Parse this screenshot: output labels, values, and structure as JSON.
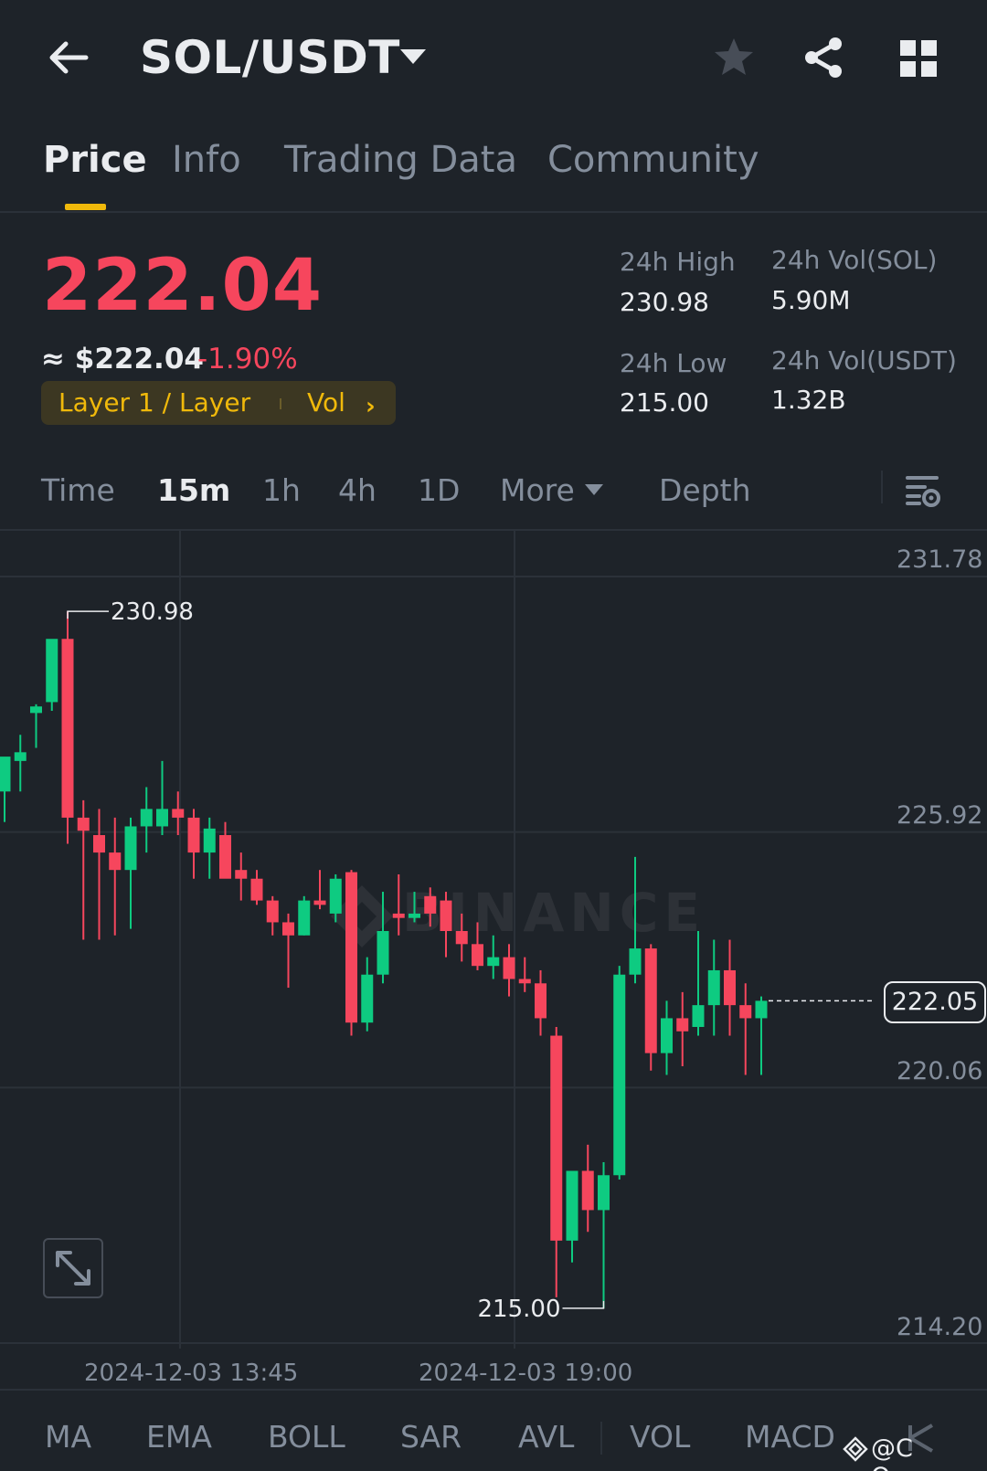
{
  "header": {
    "pair": "SOL/USDT",
    "icons": [
      "arrow-left-icon",
      "caret-down-icon",
      "star-icon",
      "share-icon",
      "grid-icon"
    ]
  },
  "tabs": [
    {
      "label": "Price",
      "active": true
    },
    {
      "label": "Info",
      "active": false
    },
    {
      "label": "Trading Data",
      "active": false
    },
    {
      "label": "Community",
      "active": false
    }
  ],
  "price": {
    "last": "222.04",
    "approx_usd": "≈ $222.04",
    "change": "-1.90%",
    "tag": "Layer 1 / Layer",
    "tag_vol": "Vol"
  },
  "stats": {
    "high_label": "24h High",
    "high_value": "230.98",
    "low_label": "24h Low",
    "low_value": "215.00",
    "vol_sol_label": "24h Vol(SOL)",
    "vol_sol_value": "5.90M",
    "vol_usdt_label": "24h Vol(USDT)",
    "vol_usdt_value": "1.32B"
  },
  "intervals": {
    "items": [
      "Time",
      "15m",
      "1h",
      "4h",
      "1D"
    ],
    "selected": "15m",
    "more": "More",
    "depth": "Depth"
  },
  "chart": {
    "y_ticks": [
      "231.78",
      "225.92",
      "220.06",
      "214.20"
    ],
    "x_ticks": [
      "2024-12-03 13:45",
      "2024-12-03 19:00"
    ],
    "high_marker": "230.98",
    "low_marker": "215.00",
    "last_price": "222.05",
    "watermark": "BINANCE",
    "colors": {
      "up": "#0ecb81",
      "down": "#f6465d",
      "accent": "#f0b90b",
      "bg": "#1e2329"
    }
  },
  "chart_data": {
    "type": "candlestick",
    "ylim": [
      214.2,
      231.78
    ],
    "y_ticks": [
      231.78,
      225.92,
      220.06,
      214.2
    ],
    "x_ticks": [
      "2024-12-03 13:45",
      "2024-12-03 19:00"
    ],
    "interval": "15m",
    "candles": [
      {
        "o": 226.85,
        "h": 227.05,
        "l": 226.15,
        "c": 227.65
      },
      {
        "o": 227.55,
        "h": 228.15,
        "l": 226.85,
        "c": 227.75
      },
      {
        "o": 228.65,
        "h": 228.85,
        "l": 227.85,
        "c": 228.8
      },
      {
        "o": 228.9,
        "h": 230.25,
        "l": 228.7,
        "c": 230.35
      },
      {
        "o": 230.35,
        "h": 230.98,
        "l": 225.65,
        "c": 226.25
      },
      {
        "o": 226.25,
        "h": 226.65,
        "l": 223.45,
        "c": 225.95
      },
      {
        "o": 225.85,
        "h": 226.45,
        "l": 223.45,
        "c": 225.45
      },
      {
        "o": 225.45,
        "h": 226.25,
        "l": 223.55,
        "c": 225.05
      },
      {
        "o": 225.05,
        "h": 226.25,
        "l": 223.7,
        "c": 226.05
      },
      {
        "o": 226.05,
        "h": 226.95,
        "l": 225.45,
        "c": 226.45
      },
      {
        "o": 226.05,
        "h": 227.55,
        "l": 225.85,
        "c": 226.45
      },
      {
        "o": 226.45,
        "h": 226.85,
        "l": 225.85,
        "c": 226.25
      },
      {
        "o": 226.25,
        "h": 226.45,
        "l": 224.85,
        "c": 225.45
      },
      {
        "o": 225.45,
        "h": 226.25,
        "l": 224.85,
        "c": 226.0
      },
      {
        "o": 225.85,
        "h": 226.15,
        "l": 225.05,
        "c": 224.85
      },
      {
        "o": 225.05,
        "h": 225.45,
        "l": 224.35,
        "c": 224.85
      },
      {
        "o": 224.85,
        "h": 225.05,
        "l": 224.25,
        "c": 224.35
      },
      {
        "o": 224.35,
        "h": 224.45,
        "l": 223.55,
        "c": 223.85
      },
      {
        "o": 223.85,
        "h": 224.05,
        "l": 222.35,
        "c": 223.55
      },
      {
        "o": 223.55,
        "h": 224.45,
        "l": 223.55,
        "c": 224.35
      },
      {
        "o": 224.35,
        "h": 225.05,
        "l": 224.15,
        "c": 224.25
      },
      {
        "o": 224.05,
        "h": 224.95,
        "l": 223.85,
        "c": 224.85
      },
      {
        "o": 225.0,
        "h": 225.05,
        "l": 221.25,
        "c": 221.55
      },
      {
        "o": 221.55,
        "h": 223.05,
        "l": 221.35,
        "c": 222.65
      },
      {
        "o": 222.65,
        "h": 224.55,
        "l": 222.45,
        "c": 223.65
      },
      {
        "o": 224.05,
        "h": 224.95,
        "l": 223.55,
        "c": 223.95
      },
      {
        "o": 223.95,
        "h": 224.55,
        "l": 223.85,
        "c": 224.05
      },
      {
        "o": 224.45,
        "h": 224.65,
        "l": 223.75,
        "c": 224.05
      },
      {
        "o": 224.35,
        "h": 224.55,
        "l": 223.05,
        "c": 223.65
      },
      {
        "o": 223.65,
        "h": 224.05,
        "l": 222.95,
        "c": 223.35
      },
      {
        "o": 223.35,
        "h": 223.85,
        "l": 222.75,
        "c": 222.85
      },
      {
        "o": 222.85,
        "h": 223.55,
        "l": 222.55,
        "c": 223.05
      },
      {
        "o": 223.05,
        "h": 223.35,
        "l": 222.15,
        "c": 222.55
      },
      {
        "o": 222.55,
        "h": 223.05,
        "l": 222.25,
        "c": 222.45
      },
      {
        "o": 222.45,
        "h": 222.75,
        "l": 221.25,
        "c": 221.65
      },
      {
        "o": 221.25,
        "h": 221.45,
        "l": 215.25,
        "c": 216.55
      },
      {
        "o": 216.55,
        "h": 218.05,
        "l": 216.05,
        "c": 218.15
      },
      {
        "o": 218.15,
        "h": 218.75,
        "l": 216.75,
        "c": 217.25
      },
      {
        "o": 217.25,
        "h": 218.35,
        "l": 215.0,
        "c": 218.05
      },
      {
        "o": 218.05,
        "h": 222.85,
        "l": 217.95,
        "c": 222.65
      },
      {
        "o": 222.65,
        "h": 225.35,
        "l": 222.45,
        "c": 223.25
      },
      {
        "o": 223.25,
        "h": 223.35,
        "l": 220.45,
        "c": 220.85
      },
      {
        "o": 220.85,
        "h": 222.05,
        "l": 220.35,
        "c": 221.65
      },
      {
        "o": 221.65,
        "h": 222.25,
        "l": 220.55,
        "c": 221.35
      },
      {
        "o": 221.45,
        "h": 223.65,
        "l": 221.25,
        "c": 221.95
      },
      {
        "o": 221.95,
        "h": 223.45,
        "l": 221.25,
        "c": 222.75
      },
      {
        "o": 222.75,
        "h": 223.45,
        "l": 221.25,
        "c": 221.95
      },
      {
        "o": 221.95,
        "h": 222.45,
        "l": 220.35,
        "c": 221.65
      },
      {
        "o": 221.65,
        "h": 222.15,
        "l": 220.35,
        "c": 222.05
      }
    ],
    "high_label": 230.98,
    "low_label": 215.0,
    "last_price": 222.05
  },
  "indicators": {
    "items": [
      "MA",
      "EMA",
      "BOLL",
      "SAR",
      "AVL",
      "VOL",
      "MACD"
    ]
  },
  "watermark_corner": "@C Queen"
}
